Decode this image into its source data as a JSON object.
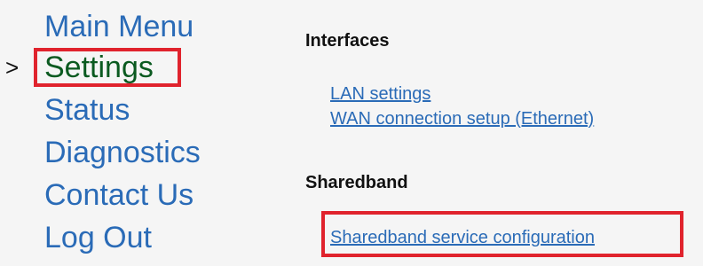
{
  "nav": {
    "current_marker": ">",
    "items": [
      {
        "label": "Main Menu"
      },
      {
        "label": "Settings"
      },
      {
        "label": "Status"
      },
      {
        "label": "Diagnostics"
      },
      {
        "label": "Contact Us"
      },
      {
        "label": "Log Out"
      }
    ]
  },
  "content": {
    "sections": [
      {
        "title": "Interfaces",
        "links": [
          {
            "label": "LAN settings"
          },
          {
            "label": "WAN connection setup (Ethernet)"
          }
        ]
      },
      {
        "title": "Sharedband",
        "links": [
          {
            "label": "Sharedband service configuration"
          }
        ]
      }
    ]
  },
  "colors": {
    "link": "#2a6bb7",
    "active_nav": "#0b5a20",
    "highlight": "#e0232d",
    "background": "#f5f5f5"
  }
}
